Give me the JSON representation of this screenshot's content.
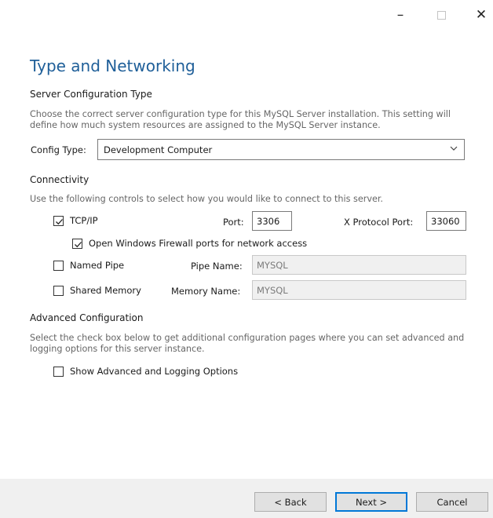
{
  "window": {
    "minimize": "–",
    "close": "✕"
  },
  "page": {
    "title": "Type and Networking"
  },
  "server_config": {
    "heading": "Server Configuration Type",
    "description": "Choose the correct server configuration type for this MySQL Server installation. This setting will define how much system resources are assigned to the MySQL Server instance.",
    "config_type_label": "Config Type:",
    "config_type_value": "Development Computer"
  },
  "connectivity": {
    "heading": "Connectivity",
    "description": "Use the following controls to select how you would like to connect to this server.",
    "tcpip": {
      "label": "TCP/IP",
      "checked": true
    },
    "port_label": "Port:",
    "port_value": "3306",
    "xport_label": "X Protocol Port:",
    "xport_value": "33060",
    "firewall": {
      "label": "Open Windows Firewall ports for network access",
      "checked": true
    },
    "named_pipe": {
      "label": "Named Pipe",
      "checked": false
    },
    "pipe_name_label": "Pipe Name:",
    "pipe_name_value": "MYSQL",
    "shared_memory": {
      "label": "Shared Memory",
      "checked": false
    },
    "memory_name_label": "Memory Name:",
    "memory_name_value": "MYSQL"
  },
  "advanced": {
    "heading": "Advanced Configuration",
    "description": "Select the check box below to get additional configuration pages where you can set advanced and logging options for this server instance.",
    "show_advanced": {
      "label": "Show Advanced and Logging Options",
      "checked": false
    }
  },
  "footer": {
    "back_label": "< Back",
    "next_label": "Next >",
    "cancel_label": "Cancel"
  },
  "colors": {
    "title": "#1f5f99",
    "accent": "#0078d7"
  }
}
